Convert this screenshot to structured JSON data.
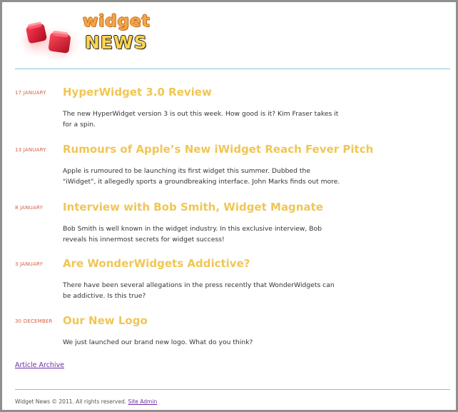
{
  "logo": {
    "line1": "widget",
    "line2": "NEWS"
  },
  "articles": [
    {
      "date": "17 JANUARY",
      "title": "HyperWidget 3.0 Review",
      "summary": "The new HyperWidget version 3 is out this week. How good is it? Kim Fraser takes it for a spin."
    },
    {
      "date": "13 JANUARY",
      "title": "Rumours of Apple’s New iWidget Reach Fever Pitch",
      "summary": "Apple is rumoured to be launching its first widget this summer. Dubbed the \"iWidget\", it allegedly sports a groundbreaking interface. John Marks finds out more."
    },
    {
      "date": "8 JANUARY",
      "title": "Interview with Bob Smith, Widget Magnate",
      "summary": "Bob Smith is well known in the widget industry. In this exclusive interview, Bob reveals his innermost secrets for widget success!"
    },
    {
      "date": "3 JANUARY",
      "title": "Are WonderWidgets Addictive?",
      "summary": "There have been several allegations in the press recently that WonderWidgets can be addictive. Is this true?"
    },
    {
      "date": "30 DECEMBER",
      "title": "Our New Logo",
      "summary": "We just launched our brand new logo. What do you think?"
    }
  ],
  "archive_link": "Article Archive",
  "footer": {
    "text": "Widget News © 2011. All rights reserved.",
    "admin_link": "Site Admin"
  },
  "colors": {
    "date": "#d56045",
    "title": "#f0c654",
    "rule": "#7fc8d4",
    "link": "#6b2fa2"
  }
}
